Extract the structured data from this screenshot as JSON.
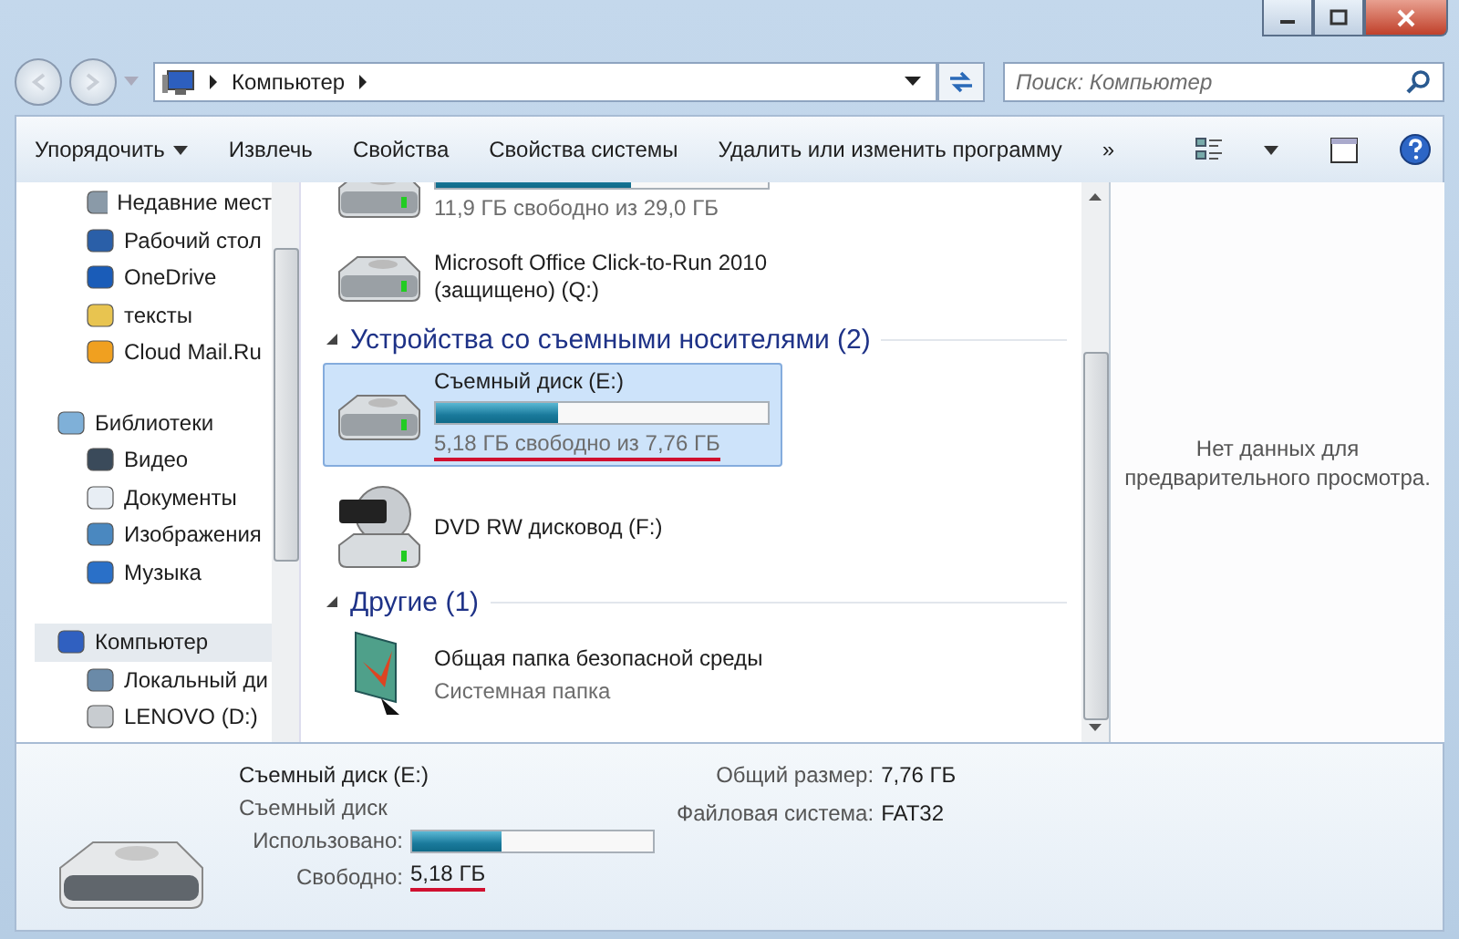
{
  "address": {
    "path": "Компьютер"
  },
  "search": {
    "placeholder": "Поиск: Компьютер"
  },
  "toolbar": [
    {
      "label": "Упорядочить",
      "kind": "menu"
    },
    {
      "label": "Извлечь",
      "kind": "button"
    },
    {
      "label": "Свойства",
      "kind": "button"
    },
    {
      "label": "Свойства системы",
      "kind": "button"
    },
    {
      "label": "Удалить или изменить программу",
      "kind": "button"
    },
    {
      "label": "»",
      "kind": "more"
    }
  ],
  "nav": [
    {
      "label": "Недавние мест",
      "kind": "recent",
      "selected": false
    },
    {
      "label": "Рабочий стол",
      "kind": "desktop",
      "selected": false
    },
    {
      "label": "OneDrive",
      "kind": "cloud",
      "selected": false
    },
    {
      "label": "тексты",
      "kind": "folder",
      "selected": false
    },
    {
      "label": "Cloud Mail.Ru",
      "kind": "mailru",
      "selected": false
    },
    {
      "label": "Библиотеки",
      "kind": "libraries",
      "selected": false
    },
    {
      "label": "Видео",
      "kind": "video",
      "selected": false
    },
    {
      "label": "Документы",
      "kind": "docs",
      "selected": false
    },
    {
      "label": "Изображения",
      "kind": "images",
      "selected": false
    },
    {
      "label": "Музыка",
      "kind": "music",
      "selected": false
    },
    {
      "label": "Компьютер",
      "kind": "computer",
      "selected": true
    },
    {
      "label": "Локальный ди",
      "kind": "system_drive",
      "selected": false
    },
    {
      "label": "LENOVO (D:)",
      "kind": "drive",
      "selected": false
    }
  ],
  "content": [
    {
      "kind": "drive",
      "level": 0.59,
      "free": "11,9 ГБ свободно из 29,0 ГБ",
      "marked": false,
      "selected": false
    },
    {
      "kind": "drive",
      "name": "Microsoft Office Click-to-Run 2010 (защищено) (Q:)",
      "selected": false
    },
    {
      "kind": "header",
      "label": "Устройства со съемными носителями (2)"
    },
    {
      "kind": "removable",
      "name": "Съемный диск (E:)",
      "level": 0.37,
      "free": "5,18 ГБ свободно из 7,76 ГБ",
      "marked": true,
      "selected": true
    },
    {
      "kind": "dvd",
      "name": "DVD RW дисковод (F:)",
      "selected": false
    },
    {
      "kind": "header",
      "label": "Другие (1)"
    },
    {
      "kind": "system_folder",
      "name": "Общая папка безопасной среды",
      "type": "Системная папка",
      "selected": false
    }
  ],
  "preview": {
    "message": "Нет данных для предварительного просмотра."
  },
  "details": {
    "name": "Съемный диск (E:)",
    "type": "Съемный диск",
    "used_label": "Использовано:",
    "level": 0.37,
    "free_label": "Свободно:",
    "free_value": "5,18 ГБ",
    "free_marked": true,
    "size_label": "Общий размер:",
    "size_value": "7,76 ГБ",
    "fs_label": "Файловая система:",
    "fs_value": "FAT32"
  }
}
